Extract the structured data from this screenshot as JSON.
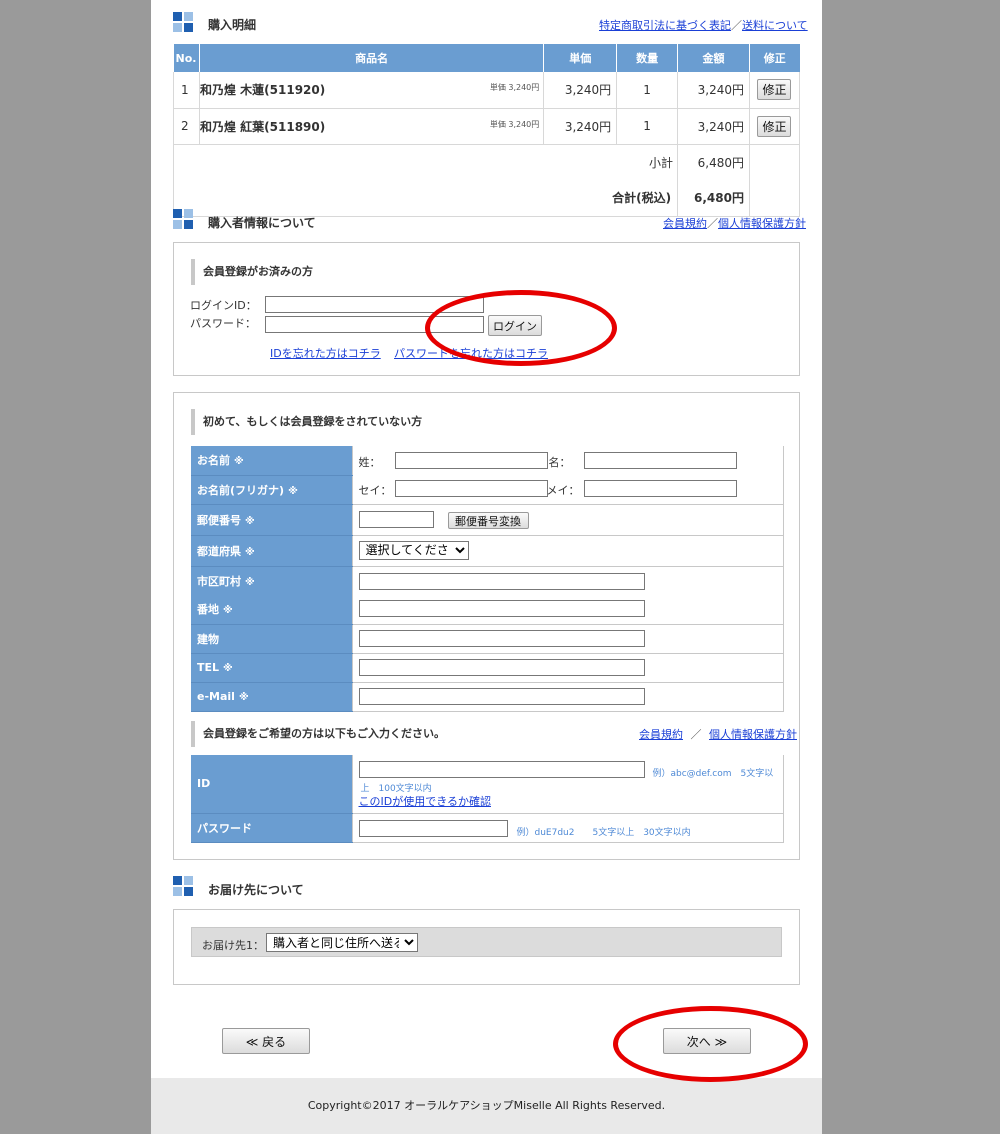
{
  "purchase": {
    "title": "購入明細",
    "link1": "特定商取引法に基づく表記",
    "sep": "／",
    "link2": "送料について",
    "headers": {
      "no": "No.",
      "name": "商品名",
      "unit": "単価",
      "qty": "数量",
      "amount": "金額",
      "edit": "修正"
    },
    "items": [
      {
        "no": "1",
        "name": "和乃煌 木蓮(511920)",
        "unit_note": "単価 3,240円",
        "unit": "3,240円",
        "qty": "1",
        "amount": "3,240円",
        "edit_label": "修正"
      },
      {
        "no": "2",
        "name": "和乃煌 紅葉(511890)",
        "unit_note": "単価 3,240円",
        "unit": "3,240円",
        "qty": "1",
        "amount": "3,240円",
        "edit_label": "修正"
      }
    ],
    "subtotal_label": "小計",
    "subtotal": "6,480円",
    "total_label": "合計(税込)",
    "total": "6,480円"
  },
  "buyer": {
    "title": "購入者情報について",
    "link1": "会員規約",
    "sep": "／",
    "link2": "個人情報保護方針"
  },
  "member_login": {
    "heading": "会員登録がお済みの方",
    "id_label": "ログインID：",
    "pw_label": "パスワード：",
    "login_button": "ログイン",
    "forgot_id": "IDを忘れた方はコチラ",
    "forgot_pw": "パスワードを忘れた方はコチラ"
  },
  "guest": {
    "heading": "初めて、もしくは会員登録をされていない方",
    "required_mark": "※",
    "name_label": "お名前",
    "last_name": "姓：",
    "first_name": "名：",
    "kana_label": "お名前(フリガナ)",
    "last_kana": "セイ：",
    "first_kana": "メイ：",
    "zip_label": "郵便番号",
    "zip_button": "郵便番号変換",
    "pref_label": "都道府県",
    "pref_selected": "選択してください",
    "city_label": "市区町村",
    "street_label": "番地",
    "building_label": "建物",
    "tel_label": "TEL",
    "email_label": "e-Mail"
  },
  "register": {
    "heading": "会員登録をご希望の方は以下もご入力ください。",
    "link1": "会員規約",
    "sep": "／",
    "link2": "個人情報保護方針",
    "id_label": "ID",
    "id_hint1": "例）abc@def.com　5文字以",
    "id_hint2": "上　100文字以内",
    "id_check": "このIDが使用できるか確認",
    "pw_label": "パスワード",
    "pw_hint": "例）duE7du2　　5文字以上　30文字以内"
  },
  "delivery": {
    "title": "お届け先について",
    "label": "お届け先1：",
    "selected": "購入者と同じ住所へ送る"
  },
  "nav": {
    "back": "≪ 戻る",
    "next": "次へ ≫"
  },
  "footer": {
    "copyright": "Copyright©2017 オーラルケアショップMiselle All Rights Reserved."
  },
  "colors": {
    "accent_blue": "#6a9dd1",
    "highlight_red": "#e60000"
  }
}
